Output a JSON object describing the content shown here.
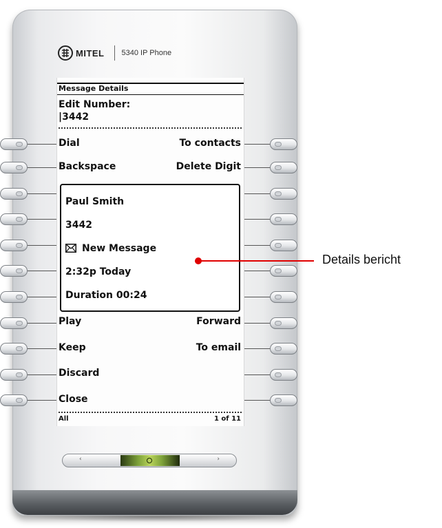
{
  "header": {
    "brand": "MITEL",
    "model": "5340 IP Phone",
    "logo_icon": "mitel-logo-icon"
  },
  "screen": {
    "title": "Message Details",
    "edit_label": "Edit Number:",
    "edit_value": "|3442",
    "top_keys": {
      "dial": "Dial",
      "to_contacts": "To contacts",
      "backspace": "Backspace",
      "delete_digit": "Delete Digit"
    },
    "details": {
      "name": "Paul Smith",
      "number": "3442",
      "status": "New Message",
      "status_icon": "envelope-icon",
      "time": "2:32p Today",
      "duration": "Duration 00:24"
    },
    "bottom_keys": {
      "play": "Play",
      "forward": "Forward",
      "keep": "Keep",
      "to_email": "To email",
      "discard": "Discard",
      "close": "Close"
    },
    "footer": {
      "filter": "All",
      "page": "1 of 11"
    }
  },
  "navigation": {
    "left": "‹",
    "right": "›",
    "center_icon": "navigation-select-icon"
  },
  "callout": {
    "label": "Details bericht",
    "color": "#e00000"
  }
}
